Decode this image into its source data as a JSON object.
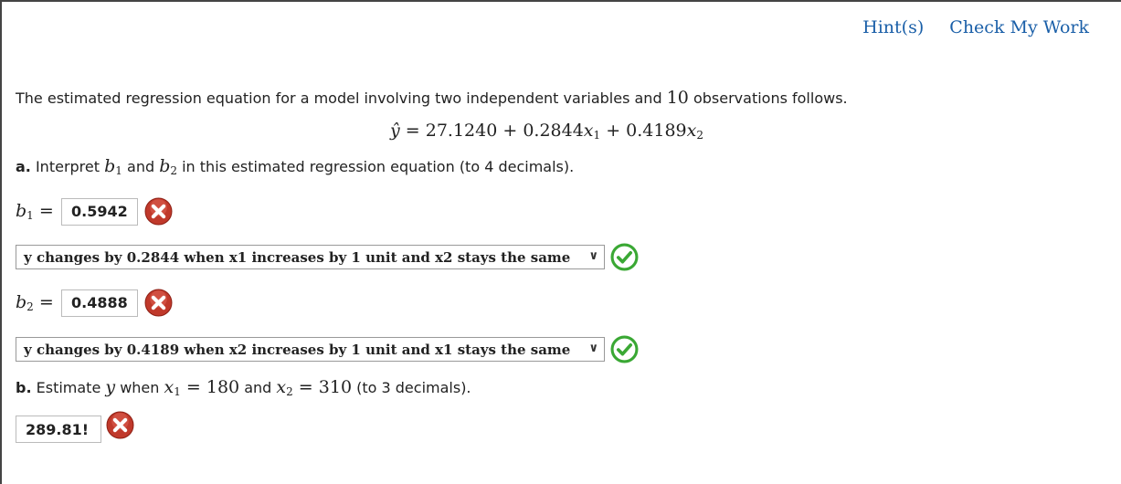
{
  "header": {
    "hints_label": "Hint(s)",
    "check_label": "Check My Work"
  },
  "intro": {
    "text_before": "The estimated regression equation for a model involving two independent variables and ",
    "n_obs": "10",
    "text_after": " observations follows."
  },
  "equation": {
    "lhs": "ŷ",
    "c0": "27.1240",
    "c1": "0.2844",
    "c2": "0.4189",
    "x": "x"
  },
  "part_a": {
    "label": "a.",
    "text_1": " Interpret ",
    "text_2": " and ",
    "text_3": " in this estimated regression equation (to 4 decimals).",
    "b1_value": "0.5942",
    "b1_select": "y changes by 0.2844 when x1 increases by 1 unit and x2 stays the same",
    "b2_value": "0.4888",
    "b2_select": "y changes by 0.4189 when x2 increases by 1 unit and x1 stays the same"
  },
  "part_b": {
    "label": "b.",
    "text_1": " Estimate ",
    "text_2": " when ",
    "x1_val": "180",
    "text_3": " and ",
    "x2_val": "310",
    "text_4": " (to 3 decimals).",
    "answer": "289.81!"
  },
  "status_colors": {
    "wrong": "#c0392b",
    "correct": "#3aa834"
  }
}
